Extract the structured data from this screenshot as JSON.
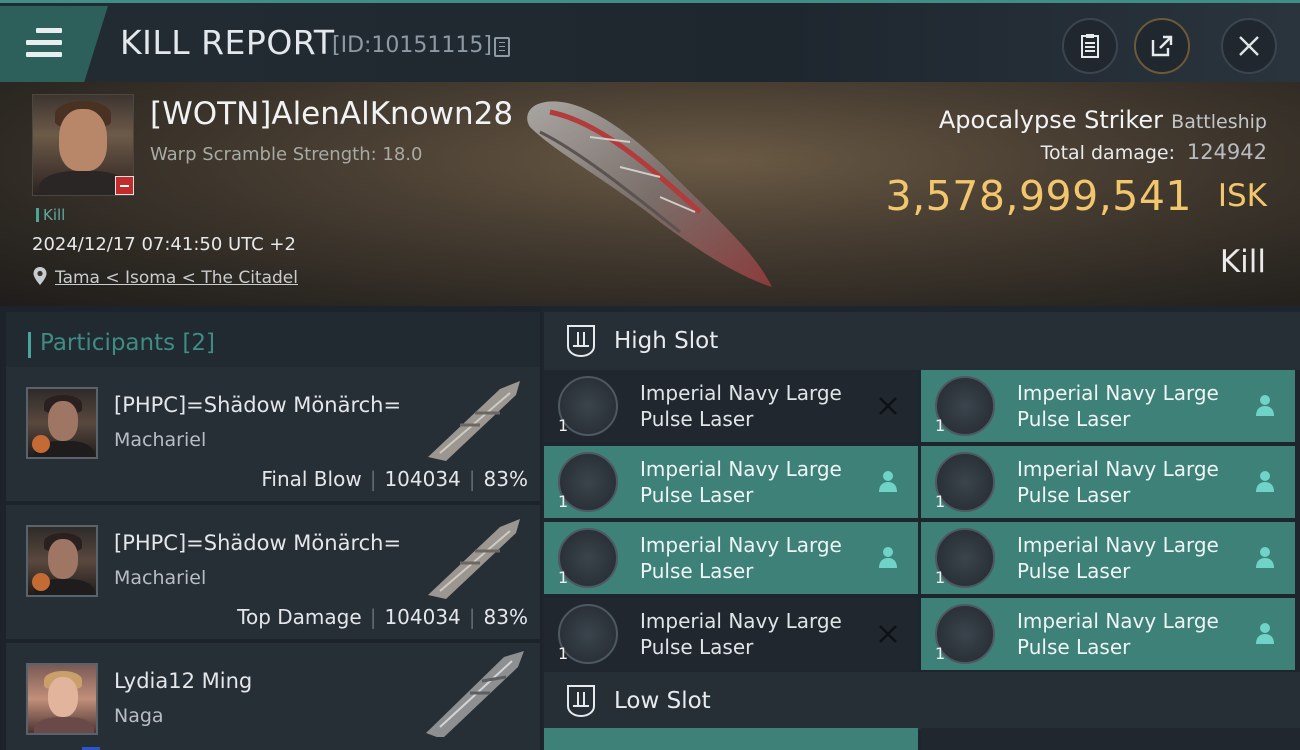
{
  "header": {
    "title": "KILL REPORT",
    "report_id": "[ID:10151115]",
    "icons": [
      "menu-icon",
      "copy-icon",
      "clipboard-icon",
      "share-icon",
      "close-icon"
    ]
  },
  "victim": {
    "name": "[WOTN]AlenAlKnown28",
    "scramble": "Warp Scramble Strength: 18.0",
    "kill_tag": "Kill",
    "datetime": "2024/12/17 07:41:50 UTC +2",
    "location": "Tama < Isoma < The Citadel",
    "ship_name": "Apocalypse Striker",
    "ship_class": "Battleship",
    "total_damage_label": "Total damage:",
    "total_damage": "124942",
    "isk_value": "3,578,999,541",
    "isk_unit": "ISK",
    "result": "Kill"
  },
  "participants": {
    "title": "Participants [2]",
    "rows": [
      {
        "name": "[PHPC]=Shädow Mönärch=",
        "ship": "Machariel",
        "role": "Final Blow",
        "damage": "104034",
        "percent": "83%"
      },
      {
        "name": "[PHPC]=Shädow Mönärch=",
        "ship": "Machariel",
        "role": "Top Damage",
        "damage": "104034",
        "percent": "83%"
      },
      {
        "name": "Lydia12 Ming",
        "ship": "Naga"
      }
    ]
  },
  "high_slot": {
    "title": "High Slot",
    "modules": [
      {
        "name_line1": "Imperial Navy Large",
        "name_line2": "Pulse Laser",
        "qty": "1",
        "status": "destroyed"
      },
      {
        "name_line1": "Imperial Navy Large",
        "name_line2": "Pulse Laser",
        "qty": "1",
        "status": "dropped"
      },
      {
        "name_line1": "Imperial Navy Large",
        "name_line2": "Pulse Laser",
        "qty": "1",
        "status": "dropped"
      },
      {
        "name_line1": "Imperial Navy Large",
        "name_line2": "Pulse Laser",
        "qty": "1",
        "status": "dropped"
      },
      {
        "name_line1": "Imperial Navy Large",
        "name_line2": "Pulse Laser",
        "qty": "1",
        "status": "dropped"
      },
      {
        "name_line1": "Imperial Navy Large",
        "name_line2": "Pulse Laser",
        "qty": "1",
        "status": "dropped"
      },
      {
        "name_line1": "Imperial Navy Large",
        "name_line2": "Pulse Laser",
        "qty": "1",
        "status": "destroyed"
      },
      {
        "name_line1": "Imperial Navy Large",
        "name_line2": "Pulse Laser",
        "qty": "1",
        "status": "dropped"
      }
    ]
  },
  "low_slot": {
    "title": "Low Slot"
  },
  "colors": {
    "accent": "#3e8179",
    "isk": "#f2c66c",
    "loss_badge": "#c22c2c"
  }
}
